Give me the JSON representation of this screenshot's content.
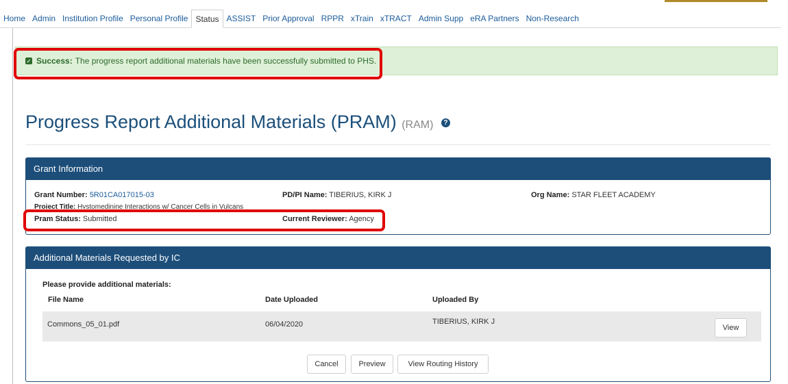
{
  "nav": {
    "tabs": [
      "Home",
      "Admin",
      "Institution Profile",
      "Personal Profile",
      "Status",
      "ASSIST",
      "Prior Approval",
      "RPPR",
      "xTrain",
      "xTRACT",
      "Admin Supp",
      "eRA Partners",
      "Non-Research"
    ],
    "active": "Status"
  },
  "alert": {
    "label": "Success:",
    "message": "The progress report additional materials have been successfully submitted to PHS."
  },
  "page": {
    "title": "Progress Report Additional Materials (PRAM)",
    "subtitle": "(RAM)",
    "help_icon": "question-circle-icon"
  },
  "grant_info": {
    "heading": "Grant Information",
    "grant_number_label": "Grant Number:",
    "grant_number": "5R01CA017015-03",
    "pdpi_label": "PD/PI Name:",
    "pdpi": "TIBERIUS, KIRK J",
    "org_label": "Org Name:",
    "org": "STAR FLEET ACADEMY",
    "project_title_label": "Project Title:",
    "project_title": "Hystomedinine Interactions w/ Cancer Cells in Vulcans",
    "pram_status_label": "Pram Status:",
    "pram_status": "Submitted",
    "reviewer_label": "Current Reviewer:",
    "reviewer": "Agency"
  },
  "materials": {
    "heading": "Additional Materials Requested by IC",
    "prompt": "Please provide additional materials:",
    "columns": [
      "File Name",
      "Date Uploaded",
      "Uploaded By"
    ],
    "rows": [
      {
        "file": "Commons_05_01.pdf",
        "date": "06/04/2020",
        "by": "TIBERIUS, KIRK J",
        "action": "View"
      }
    ]
  },
  "buttons": {
    "cancel": "Cancel",
    "preview": "Preview",
    "routing": "View Routing History"
  },
  "colors": {
    "panel_header": "#1d4e7a",
    "success_bg": "#dff0d8",
    "highlight": "#e00000"
  }
}
